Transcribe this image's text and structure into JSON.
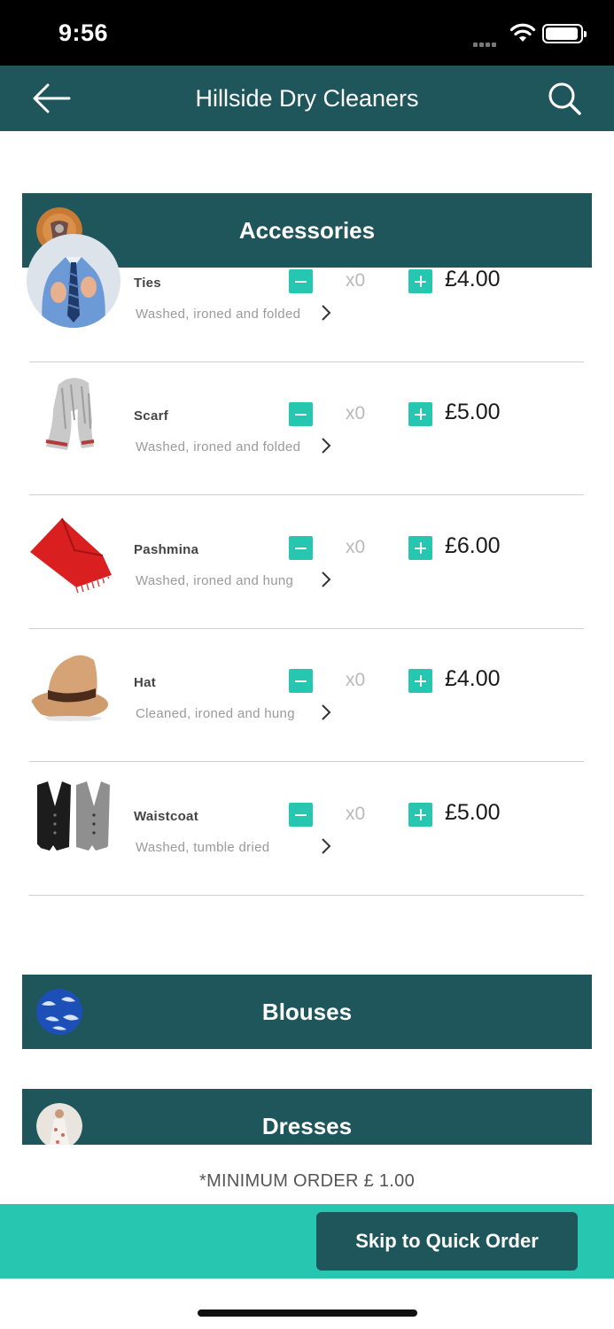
{
  "status_bar": {
    "time": "9:56"
  },
  "nav": {
    "title": "Hillside Dry Cleaners",
    "back_icon": "arrow-left-icon",
    "search_icon": "search-icon"
  },
  "sections": [
    {
      "title": "Accessories"
    },
    {
      "title": "Blouses"
    },
    {
      "title": "Dresses"
    }
  ],
  "items": [
    {
      "name": "Ties",
      "description": "Washed, ironed and folded",
      "qty": "x0",
      "price": "£4.00",
      "image": "tie-photo"
    },
    {
      "name": "Scarf",
      "description": "Washed, ironed and folded",
      "qty": "x0",
      "price": "£5.00",
      "image": "scarf-photo"
    },
    {
      "name": "Pashmina",
      "description": "Washed, ironed and hung",
      "qty": "x0",
      "price": "£6.00",
      "image": "pashmina-photo"
    },
    {
      "name": "Hat",
      "description": "Cleaned, ironed and hung",
      "qty": "x0",
      "price": "£4.00",
      "image": "hat-photo"
    },
    {
      "name": "Waistcoat",
      "description": "Washed, tumble dried",
      "qty": "x0",
      "price": "£5.00",
      "image": "waistcoat-photo"
    }
  ],
  "footer": {
    "minimum_order": "*MINIMUM ORDER £ 1.00",
    "skip_label": "Skip to Quick Order"
  },
  "colors": {
    "header": "#1f565b",
    "accent": "#26c6b0"
  }
}
